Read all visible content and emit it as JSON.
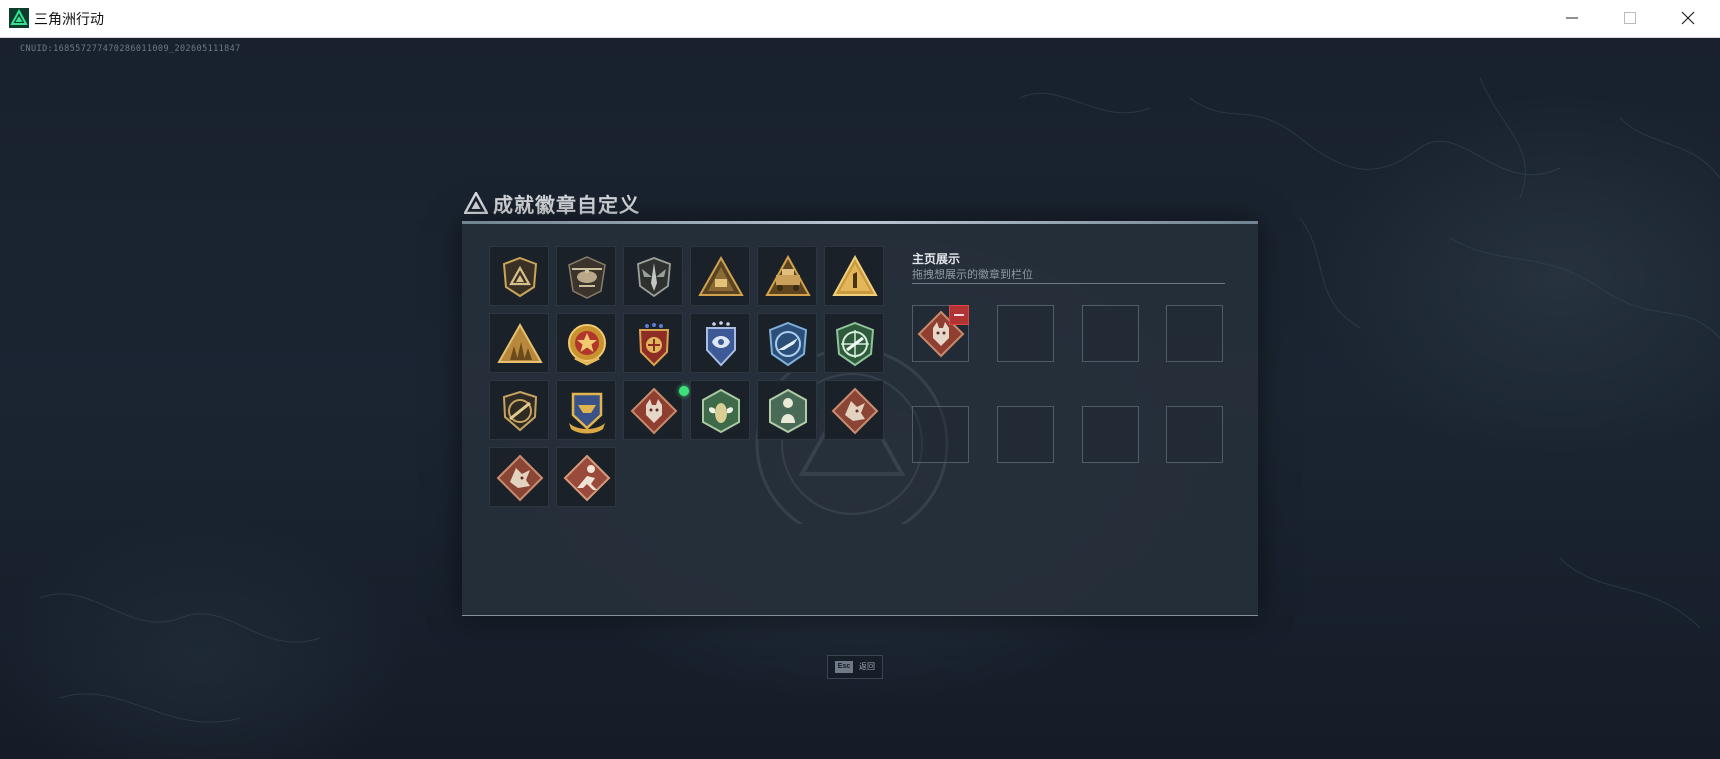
{
  "window": {
    "title": "三角洲行动",
    "controls": [
      "minimize-icon",
      "maximize-icon",
      "close-icon"
    ]
  },
  "uid_text": "CNUID:168557277470286011009_202605111847",
  "panel": {
    "title": "成就徽章自定义",
    "title_icon": "delta-logo-icon",
    "badges": [
      {
        "icon": "shield-triangle-badge"
      },
      {
        "icon": "helicopter-badge"
      },
      {
        "icon": "winged-dagger-badge"
      },
      {
        "icon": "triangle-pyramid-badge"
      },
      {
        "icon": "triangle-vehicle-badge"
      },
      {
        "icon": "triangle-number-one-badge"
      },
      {
        "icon": "triangle-soldiers-badge"
      },
      {
        "icon": "star-medal-badge"
      },
      {
        "icon": "crest-stars-badge"
      },
      {
        "icon": "blue-eagle-badge"
      },
      {
        "icon": "blue-aircraft-badge"
      },
      {
        "icon": "green-target-badge"
      },
      {
        "icon": "rifle-shield-badge"
      },
      {
        "icon": "scroll-crest-badge"
      },
      {
        "icon": "wolf-diamond-badge",
        "new": true
      },
      {
        "icon": "hornet-hexagon-badge"
      },
      {
        "icon": "runner-hexagon-badge"
      },
      {
        "icon": "dragon-diamond-badge"
      },
      {
        "icon": "dragon-diamond-badge"
      },
      {
        "icon": "fighter-diamond-badge"
      }
    ],
    "showcase": {
      "title": "主页展示",
      "subtitle": "拖拽想展示的徽章到栏位",
      "slots": [
        {
          "icon": "wolf-diamond-badge",
          "removable": true
        },
        {
          "icon": null
        },
        {
          "icon": null
        },
        {
          "icon": null
        },
        {
          "icon": null
        },
        {
          "icon": null
        },
        {
          "icon": null
        },
        {
          "icon": null
        }
      ]
    }
  },
  "footer": {
    "key": "Esc",
    "label": "返回"
  },
  "colors": {
    "accent_green": "#3ee07a",
    "remove_red": "#b13434",
    "gold": "#c9a55a",
    "copper": "#a65a45",
    "badge_blue": "#4a6fa8",
    "badge_green": "#4f7d5a"
  }
}
